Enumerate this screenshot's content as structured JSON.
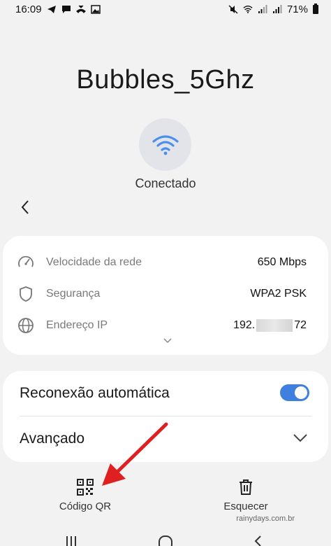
{
  "status_bar": {
    "time": "16:09",
    "battery": "71%",
    "left_icons": [
      "telegram-icon",
      "message-icon",
      "missed-call-icon",
      "image-icon"
    ],
    "right_icons": [
      "mute-icon",
      "wifi-icon",
      "signal-icon",
      "signal-icon",
      "battery-icon"
    ]
  },
  "network": {
    "name": "Bubbles_5Ghz",
    "status": "Conectado"
  },
  "details": {
    "speed": {
      "label": "Velocidade da rede",
      "value": "650 Mbps"
    },
    "security": {
      "label": "Segurança",
      "value": "WPA2 PSK"
    },
    "ip": {
      "label": "Endereço IP",
      "value_start": "192.",
      "value_end": "72"
    }
  },
  "settings": {
    "auto_reconnect": {
      "label": "Reconexão automática",
      "enabled": true
    },
    "advanced": {
      "label": "Avançado"
    }
  },
  "actions": {
    "qr": {
      "label": "Código QR"
    },
    "forget": {
      "label": "Esquecer"
    }
  },
  "watermark": "rainydays.com.br",
  "colors": {
    "accent": "#3e7fe0",
    "wifi_icon": "#4a8ff0",
    "background": "#f2f2f2",
    "card": "#ffffff",
    "annotation_arrow": "#e02020"
  }
}
